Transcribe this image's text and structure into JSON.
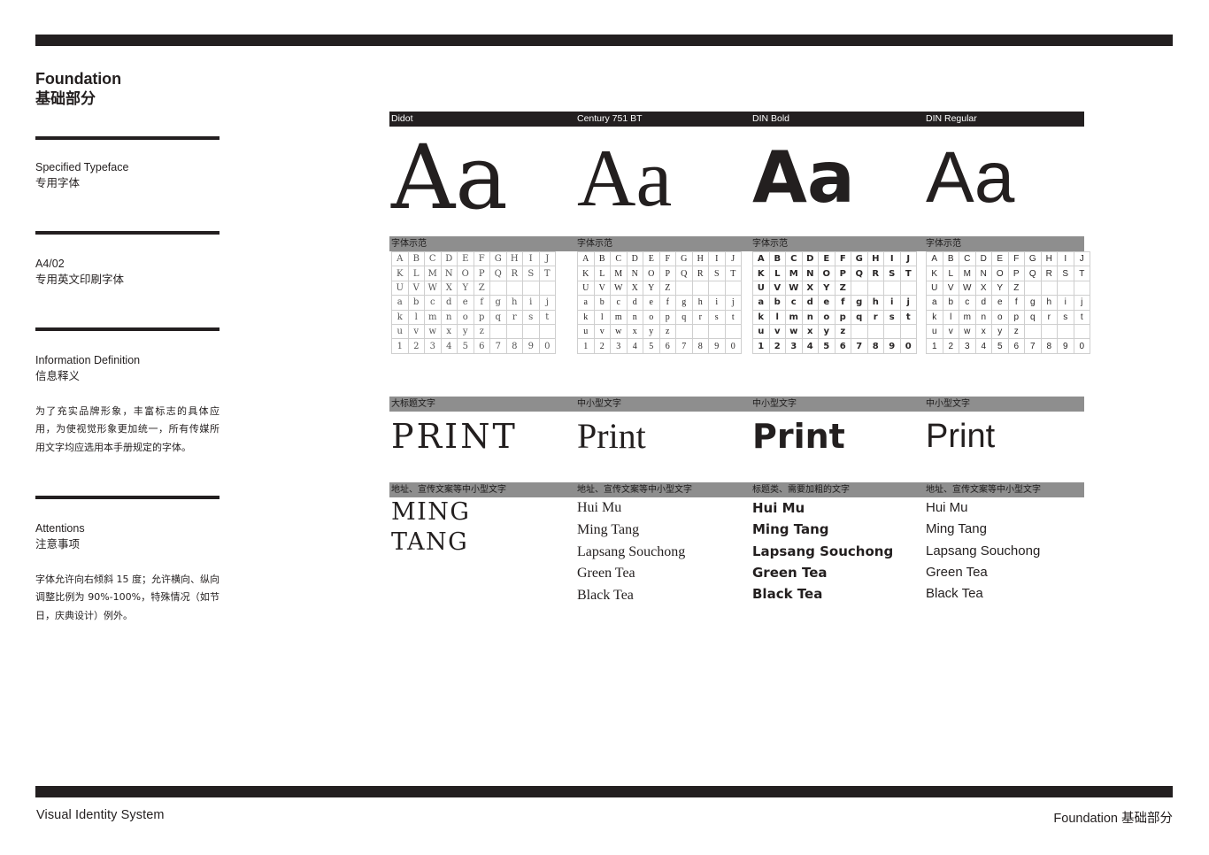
{
  "page": {
    "top_rule": "",
    "bottom_rule": ""
  },
  "sidebar": {
    "title_en": "Foundation",
    "title_cn": "基础部分",
    "section1_en": "Specified Typeface",
    "section1_cn": "专用字体",
    "section2_code": "A4/02",
    "section2_cn": "专用英文印刷字体",
    "section3_en": "Information Definition",
    "section3_cn": "信息释义",
    "section3_body": "为了充实品牌形象，丰富标志的具体应用，为使视觉形象更加统一，所有传媒所用文字均应选用本手册规定的字体。",
    "section4_en": "Attentions",
    "section4_cn": "注意事项",
    "section4_body": "字体允许向右倾斜 15 度；允许横向、纵向调整比例为 90%-100%，特殊情况（如节日，庆典设计）例外。"
  },
  "specimen": {
    "typeface_names": [
      "Didot",
      "Century 751 BT",
      "DIN Bold",
      "DIN Regular"
    ],
    "aa_samples": [
      "Aa",
      "Aa",
      "Aa",
      "Aa"
    ],
    "grid_band_labels": [
      "字体示范",
      "字体示范",
      "字体示范",
      "字体示范"
    ],
    "glyph_rows": [
      [
        "A",
        "B",
        "C",
        "D",
        "E",
        "F",
        "G",
        "H",
        "I",
        "J"
      ],
      [
        "K",
        "L",
        "M",
        "N",
        "O",
        "P",
        "Q",
        "R",
        "S",
        "T"
      ],
      [
        "U",
        "V",
        "W",
        "X",
        "Y",
        "Z",
        "",
        "",
        "",
        ""
      ],
      [
        "a",
        "b",
        "c",
        "d",
        "e",
        "f",
        "g",
        "h",
        "i",
        "j"
      ],
      [
        "k",
        "l",
        "m",
        "n",
        "o",
        "p",
        "q",
        "r",
        "s",
        "t"
      ],
      [
        "u",
        "v",
        "w",
        "x",
        "y",
        "z",
        "",
        "",
        "",
        ""
      ],
      [
        "1",
        "2",
        "3",
        "4",
        "5",
        "6",
        "7",
        "8",
        "9",
        "0"
      ]
    ],
    "size_band_labels": [
      "大标题文字",
      "中小型文字",
      "中小型文字",
      "中小型文字"
    ],
    "print_samples": [
      "PRINT",
      "Print",
      "Print",
      "Print"
    ],
    "usage_band_labels": [
      "地址、宣传文案等中小型文字",
      "地址、宣传文案等中小型文字",
      "标题类、需要加粗的文字",
      "地址、宣传文案等中小型文字"
    ],
    "word_lists": [
      [
        "MING",
        "TANG"
      ],
      [
        "Hui Mu",
        "Ming Tang",
        "Lapsang Souchong",
        "Green Tea",
        "Black Tea"
      ],
      [
        "Hui Mu",
        "Ming Tang",
        "Lapsang Souchong",
        "Green Tea",
        "Black Tea"
      ],
      [
        "Hui Mu",
        "Ming Tang",
        "Lapsang Souchong",
        "Green Tea",
        "Black Tea"
      ]
    ]
  },
  "footer": {
    "left": "Visual Identity System",
    "right_en": "Foundation",
    "right_cn": "基础部分"
  },
  "colors": {
    "ink": "#231f20",
    "gray_band": "#8e8e8e",
    "paper": "#ffffff"
  }
}
